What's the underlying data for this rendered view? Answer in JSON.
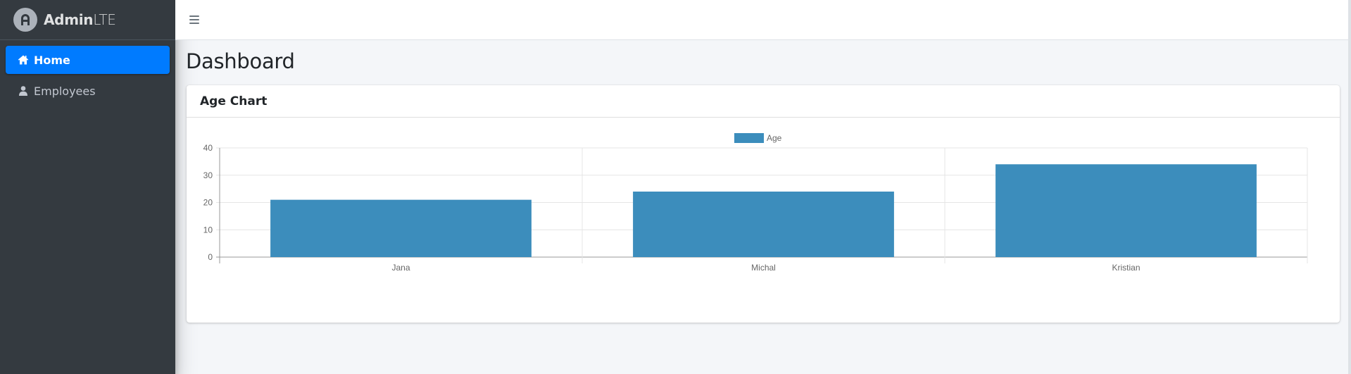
{
  "brand": {
    "name_bold": "Admin",
    "name_light": "LTE"
  },
  "sidebar": {
    "items": [
      {
        "label": "Home",
        "icon": "home-icon",
        "active": true
      },
      {
        "label": "Employees",
        "icon": "user-icon",
        "active": false
      }
    ]
  },
  "page": {
    "title": "Dashboard"
  },
  "card": {
    "title": "Age Chart"
  },
  "colors": {
    "bar": "#3c8dbc",
    "sidebar": "#343a40",
    "active": "#007bff"
  },
  "chart_data": {
    "type": "bar",
    "categories": [
      "Jana",
      "Michal",
      "Kristian"
    ],
    "series": [
      {
        "name": "Age",
        "values": [
          21,
          24,
          34
        ]
      }
    ],
    "ylim": [
      0,
      40
    ],
    "yticks": [
      0,
      10,
      20,
      30,
      40
    ],
    "legend": "top-center",
    "grid": true
  }
}
